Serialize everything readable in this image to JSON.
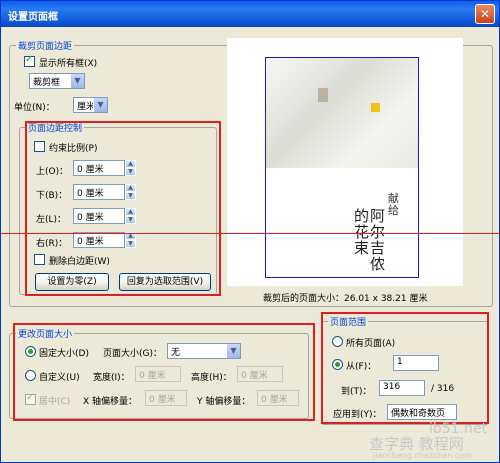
{
  "window": {
    "title": "设置页面框",
    "close_symbol": "✕"
  },
  "crop_margin": {
    "title": "裁剪页面边距",
    "show_all_boxes_label": "显示所有框(X)",
    "box_select": "裁剪框",
    "unit_label": "单位(N)：",
    "unit_value": "厘米"
  },
  "margin_control": {
    "title": "页面边距控制",
    "constrain_label": "约束比例(P)",
    "top_label": "上(O)：",
    "top_value": "0 厘米",
    "bottom_label": "下(B)：",
    "bottom_value": "0 厘米",
    "left_label": "左(L)：",
    "left_value": "0 厘米",
    "right_label": "右(R)：",
    "right_value": "0 厘米",
    "remove_white_label": "删除白边距(W)",
    "set_zero_button": "设置为零(Z)",
    "revert_button": "回复为选取范围(V)"
  },
  "preview": {
    "cropped_size_label": "裁剪后的页面大小：26.01 x 38.21 厘米",
    "cover_text_1": "献给",
    "cover_text_2": "阿尔吉侬",
    "cover_text_3": "的花束"
  },
  "change_page_size": {
    "title": "更改页面大小",
    "fixed_size_label": "固定大小(D)",
    "page_size_label": "页面大小(G)：",
    "page_size_value": "无",
    "custom_label": "自定义(U)",
    "width_label": "宽度(I)：",
    "width_value": "0 厘米",
    "height_label": "高度(H)：",
    "height_value": "0 厘米",
    "center_label": "居中(C)",
    "x_offset_label": "X 轴偏移量：",
    "x_offset_value": "0 厘米",
    "y_offset_label": "Y 轴偏移量：",
    "y_offset_value": "0 厘米"
  },
  "page_range": {
    "title": "页面范围",
    "all_pages_label": "所有页面(A)",
    "from_label": "从(F)：",
    "from_value": "1",
    "to_label": "到(T)：",
    "to_value": "316",
    "of_total": "/ 316",
    "apply_label": "应用到(Y)：",
    "apply_value": "偶数和奇数页"
  },
  "watermark": {
    "text1": "ib51.net",
    "text2": "查字典 教程网",
    "text3": "jiaocheng.chazidian.com"
  },
  "colors": {
    "accent": "#0046d5",
    "annotation": "#e02020",
    "titlebar": "#0a5fe8"
  }
}
